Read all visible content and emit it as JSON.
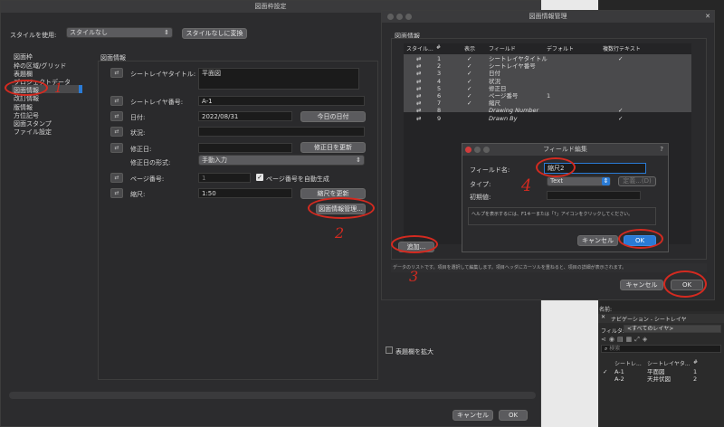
{
  "main_window": {
    "title": "図面枠設定",
    "style_label": "スタイルを使用:",
    "style_value": "スタイルなし",
    "style_convert_btn": "スタイルなしに変換",
    "sidebar": [
      "図面枠",
      "枠の区域/グリッド",
      "表題欄",
      "プロジェクトデータ",
      "図面情報",
      "改訂情報",
      "版情報",
      "方位記号",
      "図面スタンプ",
      "ファイル設定"
    ],
    "group_title": "図面情報",
    "sheet_title_label": "シートレイヤタイトル:",
    "sheet_title_value": "平面図",
    "sheet_number_label": "シートレイヤ番号:",
    "sheet_number_value": "A-1",
    "date_label": "日付:",
    "date_value": "2022/08/31",
    "today_btn": "今日の日付",
    "status_label": "状況:",
    "modified_date_label": "修正日:",
    "update_modified_btn": "修正日を更新",
    "modified_format_label": "修正日の形式:",
    "modified_format_value": "手動入力",
    "page_number_label": "ページ番号:",
    "page_number_value": "1",
    "auto_page_label": "ページ番号を自動生成",
    "scale_label": "縮尺:",
    "scale_value": "1:50",
    "update_scale_btn": "縮尺を更新",
    "manage_btn": "図面情報管理...",
    "cancel": "キャンセル",
    "ok": "OK"
  },
  "manage_window": {
    "title": "図面情報管理",
    "group_title": "図面情報",
    "headers": [
      "スタイル...",
      "#",
      "表示",
      "フィールド",
      "デフォルト",
      "複数行テキスト"
    ],
    "rows": [
      {
        "num": "1",
        "shown": "✓",
        "field": "シートレイヤタイトル",
        "default": "",
        "multi": "✓",
        "italic": false
      },
      {
        "num": "2",
        "shown": "✓",
        "field": "シートレイヤ番号",
        "default": "",
        "multi": "",
        "italic": false
      },
      {
        "num": "3",
        "shown": "✓",
        "field": "日付",
        "default": "",
        "multi": "",
        "italic": false
      },
      {
        "num": "4",
        "shown": "✓",
        "field": "状況",
        "default": "",
        "multi": "",
        "italic": false
      },
      {
        "num": "5",
        "shown": "✓",
        "field": "修正日",
        "default": "",
        "multi": "",
        "italic": false
      },
      {
        "num": "6",
        "shown": "✓",
        "field": "ページ番号",
        "default": "1",
        "multi": "",
        "italic": false
      },
      {
        "num": "7",
        "shown": "✓",
        "field": "縮尺",
        "default": "",
        "multi": "",
        "italic": false
      },
      {
        "num": "8",
        "shown": "",
        "field": "Drawing Number",
        "default": "",
        "multi": "✓",
        "italic": true
      },
      {
        "num": "9",
        "shown": "",
        "field": "Drawn By",
        "default": "",
        "multi": "✓",
        "italic": true
      }
    ],
    "add_btn": "追加...",
    "hint": "データのリストです。項目を選択して編集します。項目ヘッダにカーソルを重ねると、項目の詳細が表示されます。",
    "cancel": "キャンセル",
    "ok": "OK"
  },
  "field_dialog": {
    "title": "フィールド編集",
    "name_label": "フィールド名:",
    "name_value": "縮尺2",
    "type_label": "タイプ:",
    "type_value": "Text",
    "choices_btn": "定義...(D)",
    "initial_label": "初期値:",
    "help": "ヘルプを表示するには、F1キーまたは「?」アイコンをクリックしてください。",
    "cancel": "キャンセル",
    "ok": "OK"
  },
  "nav_palette": {
    "name_label": "名前:",
    "title": "ナビゲーション - シートレイヤ",
    "filter_label": "フィルタ:",
    "filter_value": "<すべてのレイヤ>",
    "search_placeholder": "検索",
    "headers": [
      "シートレ...",
      "シートレイヤタ...",
      "#"
    ],
    "rows": [
      {
        "check": "✓",
        "id": "A-1",
        "title": "平面図",
        "num": "1"
      },
      {
        "check": "",
        "id": "A-2",
        "title": "天井伏図",
        "num": "2"
      }
    ]
  },
  "expand_label": "表題欄を拡大",
  "annotations": [
    "1",
    "2",
    "3",
    "4"
  ],
  "colors": {
    "annotation": "#d42a20",
    "ok_blue": "#2a7bd6",
    "panel": "#2c2c2e"
  }
}
